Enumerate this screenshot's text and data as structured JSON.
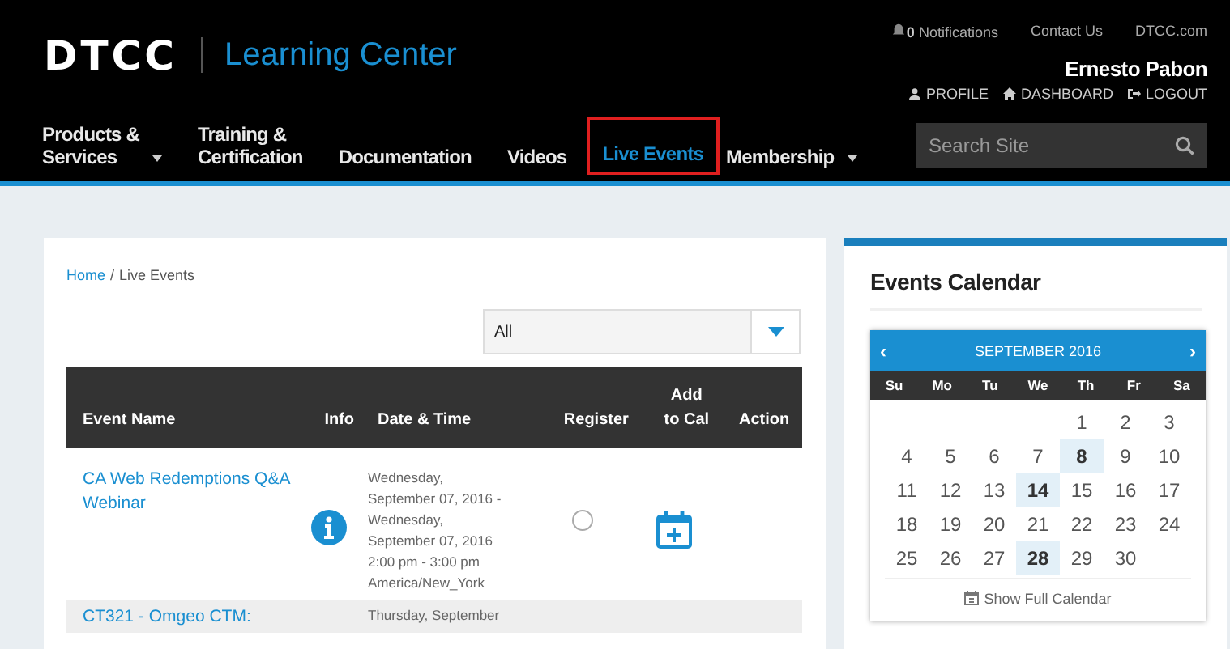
{
  "header": {
    "logo": "DTCC",
    "site_title": "Learning Center",
    "notifications": {
      "count": "0",
      "label": "Notifications"
    },
    "top_links": [
      "Contact Us",
      "DTCC.com"
    ],
    "user_name": "Ernesto Pabon",
    "user_links": [
      {
        "kind": "profile",
        "label": "PROFILE"
      },
      {
        "kind": "dashboard",
        "label": "DASHBOARD"
      },
      {
        "kind": "logout",
        "label": "LOGOUT"
      }
    ]
  },
  "nav": [
    {
      "label": "Products &\nServices",
      "dropdown": true,
      "selected": false
    },
    {
      "label": "Training &\nCertification",
      "dropdown": false,
      "selected": false
    },
    {
      "label": "Documentation",
      "dropdown": false,
      "selected": false
    },
    {
      "label": "Videos",
      "dropdown": false,
      "selected": false
    },
    {
      "label": "Live Events",
      "dropdown": false,
      "selected": true
    },
    {
      "label": "Membership",
      "dropdown": true,
      "selected": false
    }
  ],
  "search": {
    "placeholder": "Search Site"
  },
  "breadcrumb": [
    {
      "label": "Home",
      "link": true
    },
    {
      "label": "Live Events",
      "link": false
    }
  ],
  "breadcrumb_separator": "/",
  "filter": {
    "value": "All"
  },
  "table": {
    "columns": [
      "Event Name",
      "Info",
      "Date & Time",
      "Register",
      "Add\nto Cal",
      "Action"
    ],
    "rows": [
      {
        "name": "CA Web Redemptions Q&A Webinar",
        "date_lines": [
          "Wednesday,",
          "September 07, 2016 -",
          "Wednesday,",
          "September 07, 2016",
          "2:00 pm - 3:00 pm",
          "America/New_York"
        ],
        "registered": false
      },
      {
        "name": "CT321 - Omgeo CTM:",
        "date_lines": [
          "Thursday, September"
        ]
      }
    ]
  },
  "calendar": {
    "title": "Events Calendar",
    "month": "SEPTEMBER 2016",
    "prev": "‹",
    "next": "›",
    "weekdays": [
      "Su",
      "Mo",
      "Tu",
      "We",
      "Th",
      "Fr",
      "Sa"
    ],
    "days": [
      {
        "kind": "blank"
      },
      {
        "kind": "blank"
      },
      {
        "kind": "blank"
      },
      {
        "kind": "blank"
      },
      {
        "kind": "day",
        "label": "1",
        "event": false
      },
      {
        "kind": "day",
        "label": "2",
        "event": false
      },
      {
        "kind": "day",
        "label": "3",
        "event": false
      },
      {
        "kind": "day",
        "label": "4",
        "event": false
      },
      {
        "kind": "day",
        "label": "5",
        "event": false
      },
      {
        "kind": "day",
        "label": "6",
        "event": false
      },
      {
        "kind": "day",
        "label": "7",
        "event": false
      },
      {
        "kind": "day",
        "label": "8",
        "event": true
      },
      {
        "kind": "day",
        "label": "9",
        "event": false
      },
      {
        "kind": "day",
        "label": "10",
        "event": false
      },
      {
        "kind": "day",
        "label": "11",
        "event": false
      },
      {
        "kind": "day",
        "label": "12",
        "event": false
      },
      {
        "kind": "day",
        "label": "13",
        "event": false
      },
      {
        "kind": "day",
        "label": "14",
        "event": true
      },
      {
        "kind": "day",
        "label": "15",
        "event": false
      },
      {
        "kind": "day",
        "label": "16",
        "event": false
      },
      {
        "kind": "day",
        "label": "17",
        "event": false
      },
      {
        "kind": "day",
        "label": "18",
        "event": false
      },
      {
        "kind": "day",
        "label": "19",
        "event": false
      },
      {
        "kind": "day",
        "label": "20",
        "event": false
      },
      {
        "kind": "day",
        "label": "21",
        "event": false
      },
      {
        "kind": "day",
        "label": "22",
        "event": false
      },
      {
        "kind": "day",
        "label": "23",
        "event": false
      },
      {
        "kind": "day",
        "label": "24",
        "event": false
      },
      {
        "kind": "day",
        "label": "25",
        "event": false
      },
      {
        "kind": "day",
        "label": "26",
        "event": false
      },
      {
        "kind": "day",
        "label": "27",
        "event": false
      },
      {
        "kind": "day",
        "label": "28",
        "event": true
      },
      {
        "kind": "day",
        "label": "29",
        "event": false
      },
      {
        "kind": "day",
        "label": "30",
        "event": false
      }
    ],
    "footer_link": "Show Full Calendar"
  }
}
